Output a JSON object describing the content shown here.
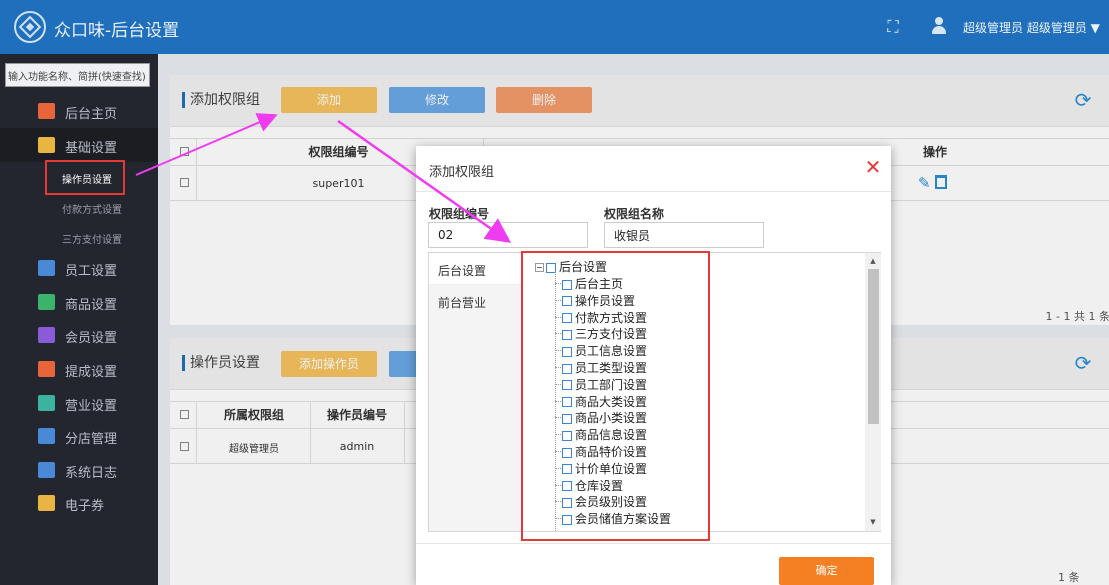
{
  "header": {
    "app_title": "众口味-后台设置",
    "user_name": "超级管理员 超级管理员 ▼"
  },
  "sidebar": {
    "search_placeholder": "输入功能名称、简拼(快速查找)",
    "items": [
      {
        "label": "后台主页",
        "icon": "home-icon",
        "color": "#e8643a"
      },
      {
        "label": "基础设置",
        "icon": "puzzle-icon",
        "color": "#e9b542"
      },
      {
        "label": "员工设置",
        "icon": "id-card-icon",
        "color": "#4a89d8"
      },
      {
        "label": "商品设置",
        "icon": "box-icon",
        "color": "#3bb36b"
      },
      {
        "label": "会员设置",
        "icon": "crown-icon",
        "color": "#8a5bd6"
      },
      {
        "label": "提成设置",
        "icon": "chart-icon",
        "color": "#e8643a"
      },
      {
        "label": "营业设置",
        "icon": "register-icon",
        "color": "#3bb39f"
      },
      {
        "label": "分店管理",
        "icon": "network-icon",
        "color": "#4a89d8"
      },
      {
        "label": "系统日志",
        "icon": "list-icon",
        "color": "#4a89d8"
      },
      {
        "label": "电子券",
        "icon": "ticket-icon",
        "color": "#e9b542"
      }
    ],
    "sub_items": [
      "操作员设置",
      "付款方式设置",
      "三方支付设置"
    ]
  },
  "panel_group": {
    "title": "添加权限组",
    "add_label": "添加",
    "edit_label": "修改",
    "delete_label": "删除",
    "col_code": "权限组编号",
    "col_action": "操作",
    "row_code": "super101",
    "pager": "1 - 1  共 1 条"
  },
  "panel_operator": {
    "title": "操作员设置",
    "add_label": "添加操作员",
    "col_group": "所属权限组",
    "col_code": "操作员编号",
    "row_group": "超级管理员",
    "row_code": "admin",
    "pager_tail": "1 条"
  },
  "modal": {
    "title": "添加权限组",
    "code_label": "权限组编号",
    "code_value": "02",
    "name_label": "权限组名称",
    "name_value": "收银员",
    "tabs": [
      "后台设置",
      "前台营业"
    ],
    "tree_root": "后台设置",
    "tree_nodes": [
      "后台主页",
      "操作员设置",
      "付款方式设置",
      "三方支付设置",
      "员工信息设置",
      "员工类型设置",
      "员工部门设置",
      "商品大类设置",
      "商品小类设置",
      "商品信息设置",
      "商品特价设置",
      "计价单位设置",
      "仓库设置",
      "会员级别设置",
      "会员储值方案设置"
    ],
    "confirm_label": "确定"
  }
}
